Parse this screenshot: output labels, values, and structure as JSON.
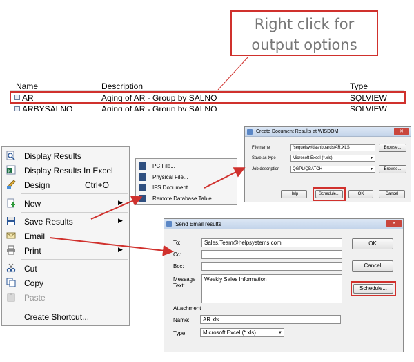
{
  "callout": {
    "line1": "Right click for",
    "line2": "output options"
  },
  "list": {
    "headers": {
      "name": "Name",
      "description": "Description",
      "type": "Type"
    },
    "rows": [
      {
        "name": "AR",
        "description": "Aging of AR - Group by SALNO",
        "type": "SQLVIEW"
      },
      {
        "name": "ARBYSALNO",
        "description": "Aging of AR - Group by SALNO",
        "type": "SQLVIEW"
      }
    ]
  },
  "context_menu": {
    "display_results": "Display Results",
    "display_results_excel": "Display Results In Excel",
    "design": "Design",
    "design_shortcut": "Ctrl+O",
    "new": "New",
    "save_results": "Save Results",
    "email": "Email",
    "print": "Print",
    "cut": "Cut",
    "copy": "Copy",
    "paste": "Paste",
    "create_shortcut": "Create Shortcut..."
  },
  "submenu": {
    "pc_file": "PC File...",
    "physical_file": "Physical File...",
    "ifs_document": "IFS Document...",
    "remote_table": "Remote Database Table..."
  },
  "create_doc_dialog": {
    "title": "Create Document Results at WISDOM",
    "file_name_label": "File name",
    "file_name_value": "/sequelsw/dashboards/AR.XLS",
    "save_as_label": "Save as type",
    "save_as_value": "Microsoft Excel (*.xls)",
    "job_desc_label": "Job description",
    "job_desc_value": "QGPL/QBATCH",
    "browse1": "Browse...",
    "browse2": "Browse...",
    "help": "Help",
    "schedule": "Schedule...",
    "ok": "OK",
    "cancel": "Cancel"
  },
  "email_dialog": {
    "title": "Send Email results",
    "to_label": "To:",
    "to_value": "Sales.Team@helpsystems.com",
    "cc_label": "Cc:",
    "bcc_label": "Bcc:",
    "message_label_1": "Message",
    "message_label_2": "Text:",
    "message_value": "Weekly Sales Information",
    "attachment_label": "Attachment",
    "name_label": "Name:",
    "name_value": "AR.xls",
    "type_label": "Type:",
    "type_value": "Microsoft Excel (*.xls)",
    "ok": "OK",
    "cancel": "Cancel",
    "schedule": "Schedule..."
  },
  "colors": {
    "highlight": "#d0312d",
    "callout_text": "#777777",
    "dialog_bg": "#f0f0f0"
  }
}
